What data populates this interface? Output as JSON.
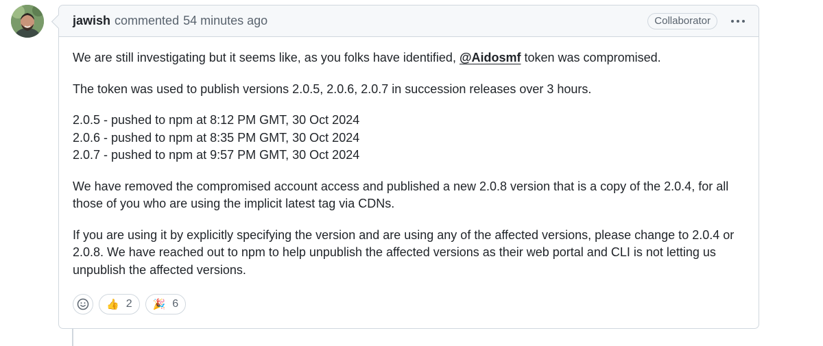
{
  "comment": {
    "author": "jawish",
    "action": "commented",
    "timestamp": "54 minutes ago",
    "role_badge": "Collaborator",
    "body": {
      "p1_before": "We are still investigating but it seems like, as you folks have identified, ",
      "p1_mention": "@Aidosmf",
      "p1_after": " token was compromised.",
      "p2": "The token was used to publish versions 2.0.5, 2.0.6, 2.0.7 in succession releases over 3 hours.",
      "versions": [
        "2.0.5 - pushed to npm at 8:12 PM GMT, 30 Oct 2024",
        "2.0.6 - pushed to npm at 8:35 PM GMT, 30 Oct 2024",
        "2.0.7 - pushed to npm at 9:57 PM GMT, 30 Oct 2024"
      ],
      "p4": "We have removed the compromised account access and published a new 2.0.8 version that is a copy of the 2.0.4, for all those of you who are using the implicit latest tag via CDNs.",
      "p5": "If you are using it by explicitly specifying the version and are using any of the affected versions, please change to 2.0.4 or 2.0.8. We have reached out to npm to help unpublish the affected versions as their web portal and CLI is not letting us unpublish the affected versions."
    },
    "reactions": [
      {
        "icon": "thumbs-up-icon",
        "emoji": "👍",
        "count": "2"
      },
      {
        "icon": "party-popper-icon",
        "emoji": "🎉",
        "count": "6"
      }
    ]
  }
}
